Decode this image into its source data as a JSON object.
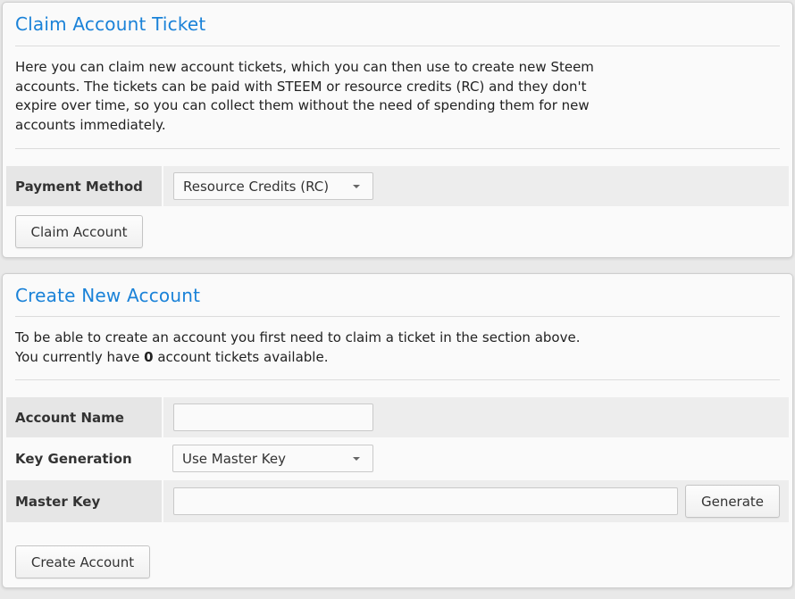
{
  "claim_section": {
    "title": "Claim Account Ticket",
    "description": "Here you can claim new account tickets, which you can then use to create new Steem accounts. The tickets can be paid with STEEM or resource credits (RC) and they don't expire over time, so you can collect them without the need of spending them for new accounts immediately.",
    "payment_method_label": "Payment Method",
    "payment_method_value": "Resource Credits (RC)",
    "claim_button": "Claim Account"
  },
  "create_section": {
    "title": "Create New Account",
    "desc_line1": "To be able to create an account you first need to claim a ticket in the section above.",
    "desc_prefix": "You currently have ",
    "ticket_count": "0",
    "desc_suffix": " account tickets available.",
    "account_name_label": "Account Name",
    "account_name_value": "",
    "key_generation_label": "Key Generation",
    "key_generation_value": "Use Master Key",
    "master_key_label": "Master Key",
    "master_key_value": "",
    "generate_button": "Generate",
    "create_button": "Create Account"
  },
  "colors": {
    "title_blue": "#1a82d8",
    "background": "#e9e9e9",
    "panel": "#fafafa"
  }
}
